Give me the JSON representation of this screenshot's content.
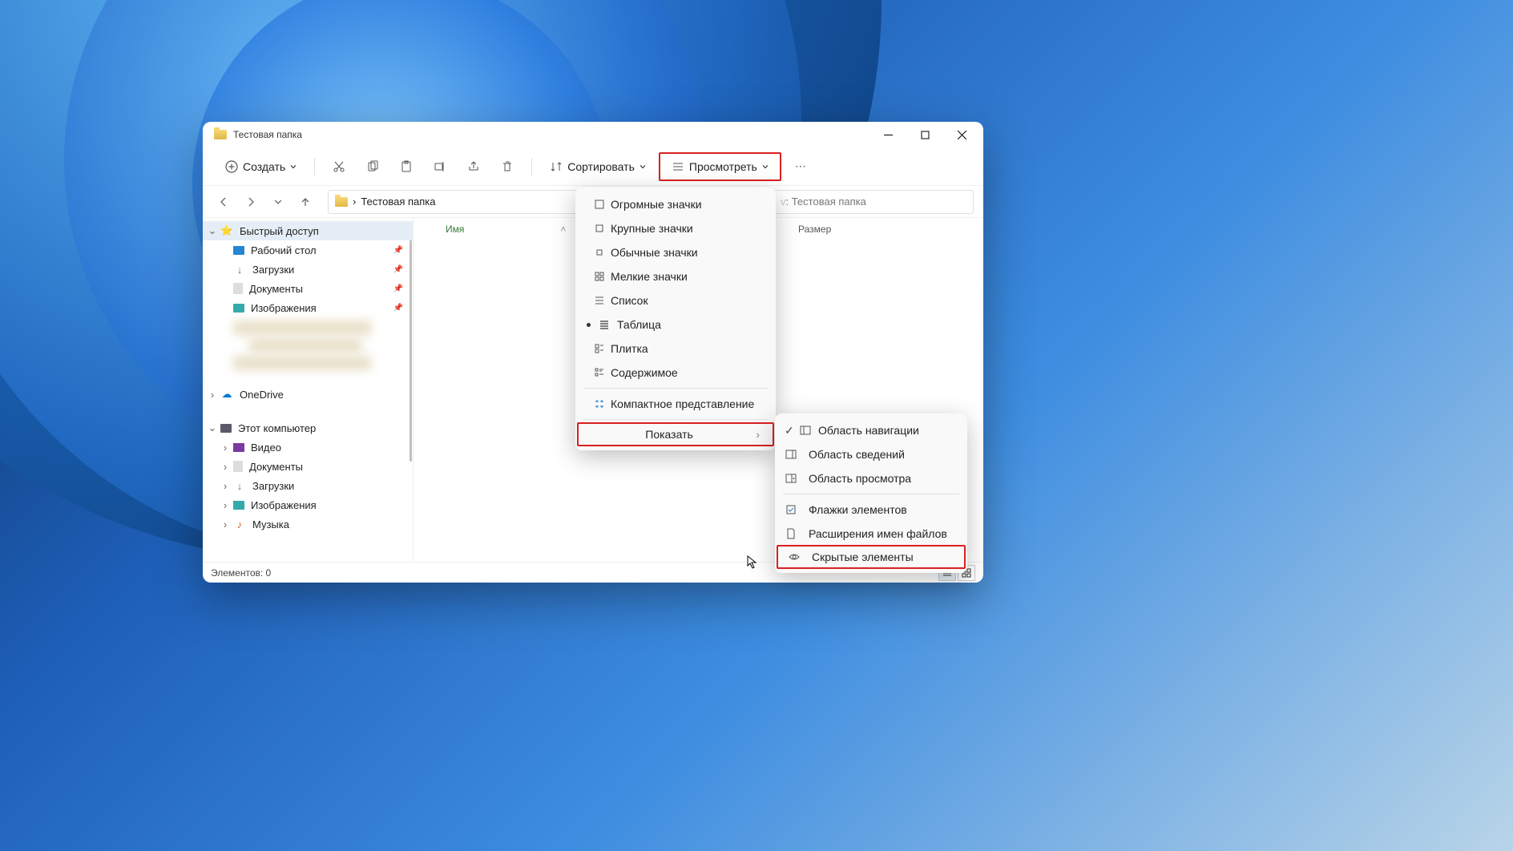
{
  "window": {
    "title": "Тестовая папка"
  },
  "toolbar": {
    "new_label": "Создать",
    "sort_label": "Сортировать",
    "view_label": "Просмотреть"
  },
  "breadcrumb": {
    "current": "Тестовая папка"
  },
  "search": {
    "placeholder": ": Тестовая папка"
  },
  "sidebar": {
    "quick_access": "Быстрый доступ",
    "desktop": "Рабочий стол",
    "downloads": "Загрузки",
    "documents": "Документы",
    "pictures": "Изображения",
    "onedrive": "OneDrive",
    "this_pc": "Этот компьютер",
    "video": "Видео",
    "documents2": "Документы",
    "downloads2": "Загрузки",
    "pictures2": "Изображения",
    "music": "Музыка"
  },
  "columns": {
    "name": "Имя",
    "size": "Размер"
  },
  "view_menu": {
    "extra_large": "Огромные значки",
    "large": "Крупные значки",
    "medium": "Обычные значки",
    "small": "Мелкие значки",
    "list": "Список",
    "details": "Таблица",
    "tiles": "Плитка",
    "content": "Содержимое",
    "compact": "Компактное представление",
    "show": "Показать"
  },
  "show_menu": {
    "nav_pane": "Область навигации",
    "details_pane": "Область сведений",
    "preview_pane": "Область просмотра",
    "item_checks": "Флажки элементов",
    "file_ext": "Расширения имен файлов",
    "hidden": "Скрытые элементы"
  },
  "status": {
    "items": "Элементов: 0"
  }
}
